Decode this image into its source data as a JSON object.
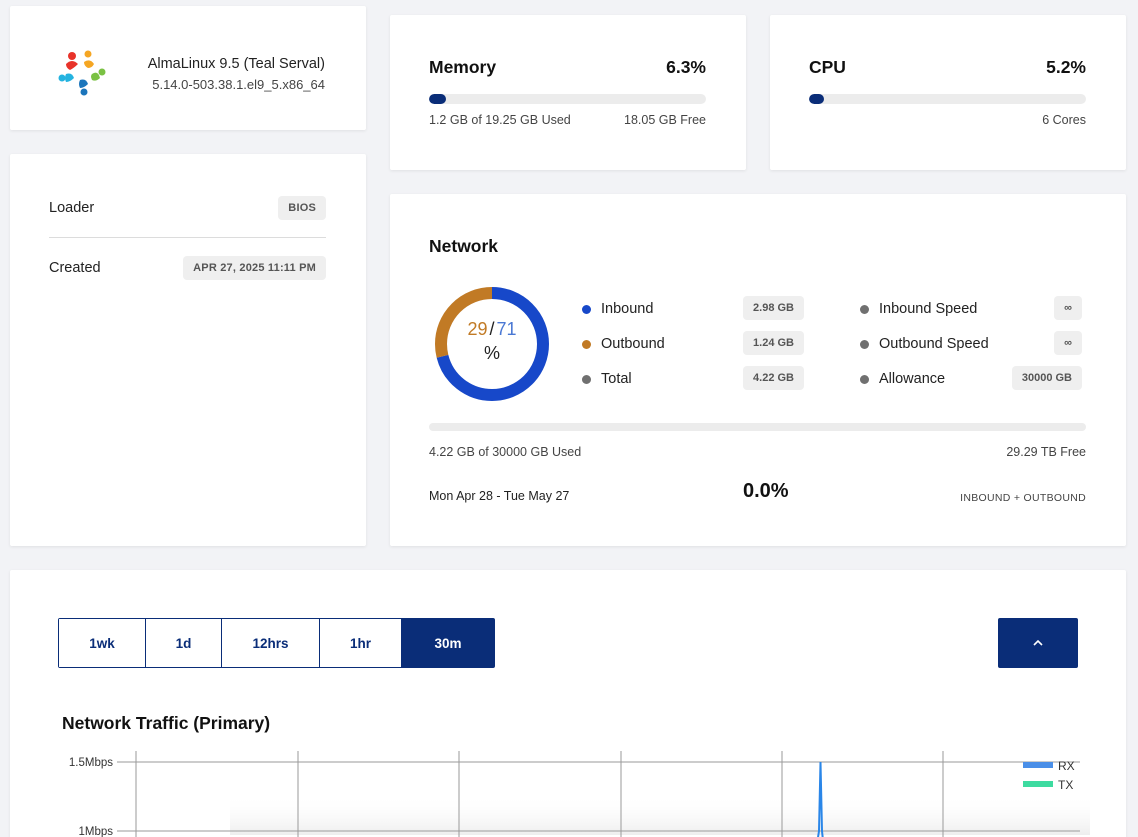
{
  "os": {
    "name": "AlmaLinux 9.5 (Teal Serval)",
    "kernel": "5.14.0-503.38.1.el9_5.x86_64",
    "logo_icon": "almalinux-logo-icon"
  },
  "meta": {
    "loader_label": "Loader",
    "loader_value": "BIOS",
    "created_label": "Created",
    "created_value": "APR 27, 2025 11:11 PM"
  },
  "memory": {
    "title": "Memory",
    "percent": "6.3%",
    "fill_fraction": 0.063,
    "used": "1.2 GB of 19.25 GB Used",
    "free": "18.05 GB Free"
  },
  "cpu": {
    "title": "CPU",
    "percent": "5.2%",
    "fill_fraction": 0.052,
    "cores": "6 Cores"
  },
  "network": {
    "title": "Network",
    "donut": {
      "outbound_pct": "29",
      "separator": "/",
      "inbound_pct": "71",
      "unit": "%",
      "outbound_fraction": 0.29,
      "inbound_fraction": 0.71
    },
    "legend_left": [
      {
        "label": "Inbound",
        "value": "2.98 GB",
        "color": "#1748c9"
      },
      {
        "label": "Outbound",
        "value": "1.24 GB",
        "color": "#c17a25"
      },
      {
        "label": "Total",
        "value": "4.22 GB",
        "color": "#707070"
      }
    ],
    "legend_right": [
      {
        "label": "Inbound Speed",
        "value": "∞",
        "color": "#707070"
      },
      {
        "label": "Outbound Speed",
        "value": "∞",
        "color": "#707070"
      },
      {
        "label": "Allowance",
        "value": "30000 GB",
        "color": "#707070"
      }
    ],
    "usage_fraction": 0.0,
    "used": "4.22 GB of 30000 GB Used",
    "free": "29.29 TB Free",
    "period": "Mon Apr 28 - Tue May 27",
    "percent": "0.0%",
    "scope": "INBOUND + OUTBOUND"
  },
  "traffic": {
    "ranges": [
      "1wk",
      "1d",
      "12hrs",
      "1hr",
      "30m"
    ],
    "active_range": "30m",
    "collapse_icon": "chevron-up-icon",
    "chart_title": "Network Traffic (Primary)"
  },
  "chart_data": {
    "type": "line",
    "title": "Network Traffic (Primary)",
    "y_ticks": [
      "1.5Mbps",
      "1Mbps"
    ],
    "series": [
      {
        "name": "RX",
        "color": "#4a8fe8"
      },
      {
        "name": "TX",
        "color": "#3ddba0"
      }
    ],
    "legend_position": "top-right",
    "grid": true
  }
}
